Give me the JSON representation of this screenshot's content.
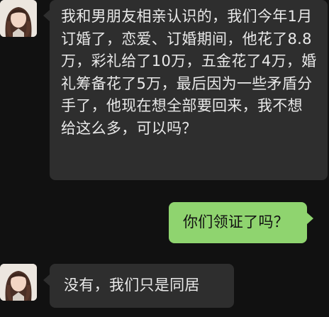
{
  "conversation": {
    "messages": [
      {
        "sender": "other",
        "avatar": "girl-avatar-icon",
        "text": "我和男朋友相亲认识的，我们今年1月订婚了，恋爱、订婚期间，他花了8.8万，彩礼给了10万，五金花了4万，婚礼筹备花了5万，最后因为一些矛盾分手了，他现在想全部要回来，我不想给这么多，可以吗？"
      },
      {
        "sender": "me",
        "text": "你们领证了吗？"
      },
      {
        "sender": "other",
        "avatar": "girl-avatar-icon",
        "text": "没有，我们只是同居"
      }
    ]
  },
  "colors": {
    "background": "#111111",
    "incoming_bubble": "#2e2e2e",
    "incoming_text": "#e9e9e9",
    "outgoing_bubble": "#8fd46f",
    "outgoing_text": "#111111"
  }
}
